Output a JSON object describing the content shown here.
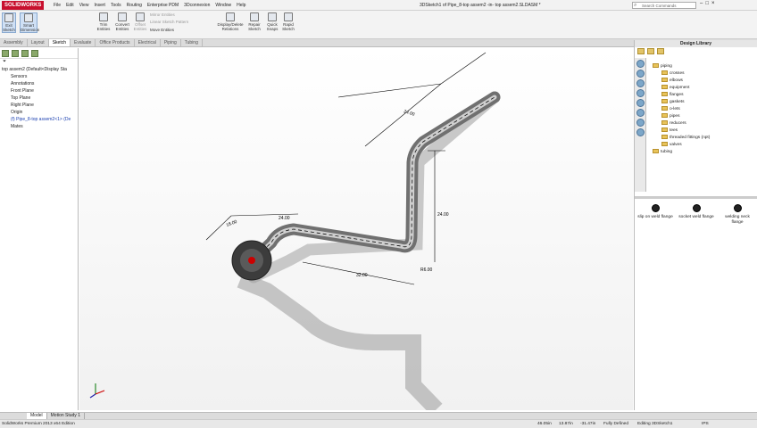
{
  "app": {
    "logo": "SOLIDWORKS",
    "doc_title": "3DSketch1 of Pipe_8-top assem2 -in- top assem2.SLDASM *"
  },
  "menus": [
    "File",
    "Edit",
    "View",
    "Insert",
    "Tools",
    "Routing",
    "Enterprise PDM",
    "3Dconnexion",
    "Window",
    "Help"
  ],
  "search": {
    "placeholder": "Search Commands"
  },
  "ribbon": {
    "buttons": [
      "Exit Sketch",
      "Smart Dimension",
      "Trim Entities",
      "Convert Entities",
      "Offset Entities",
      "Display/Delete Relations",
      "Repair Sketch",
      "Quick Snaps",
      "Rapid Sketch"
    ],
    "small": [
      "Mirror Entities",
      "Linear Sketch Pattern",
      "Move Entities"
    ]
  },
  "tabs": [
    "Assembly",
    "Layout",
    "Sketch",
    "Evaluate",
    "Office Products",
    "Electrical",
    "Piping",
    "Tubing"
  ],
  "active_tab": "Sketch",
  "tree": [
    "top assem2  (Default<Display Sta",
    "Sensors",
    "Annotations",
    "Front Plane",
    "Top Plane",
    "Right Plane",
    "Origin",
    "(f) Pipe_8-top assem2<1> (De",
    "Mates"
  ],
  "dims": {
    "d1": "24.00",
    "d2": "24.00",
    "d3": "18.00",
    "d4": "32.00",
    "r1": "R6.00",
    "d5": "24.00"
  },
  "design_library": {
    "title": "Design Library",
    "items": [
      "piping",
      "crosses",
      "elbows",
      "equipment",
      "flanges",
      "gaskets",
      "o-lets",
      "pipes",
      "reducers",
      "tees",
      "threaded fittings (npt)",
      "valves",
      "tubing"
    ],
    "files": [
      "slip on weld flange",
      "socket weld flange",
      "welding neck flange"
    ]
  },
  "bottom_tabs": [
    "Model",
    "Motion Study 1"
  ],
  "status": {
    "edition": "SolidWorks Premium 2013 x64 Edition",
    "x": "46.05in",
    "y": "13.87in",
    "z": "-31.47in",
    "state": "Fully Defined",
    "editing": "Editing 3DSketch1",
    "units": "IPS"
  }
}
